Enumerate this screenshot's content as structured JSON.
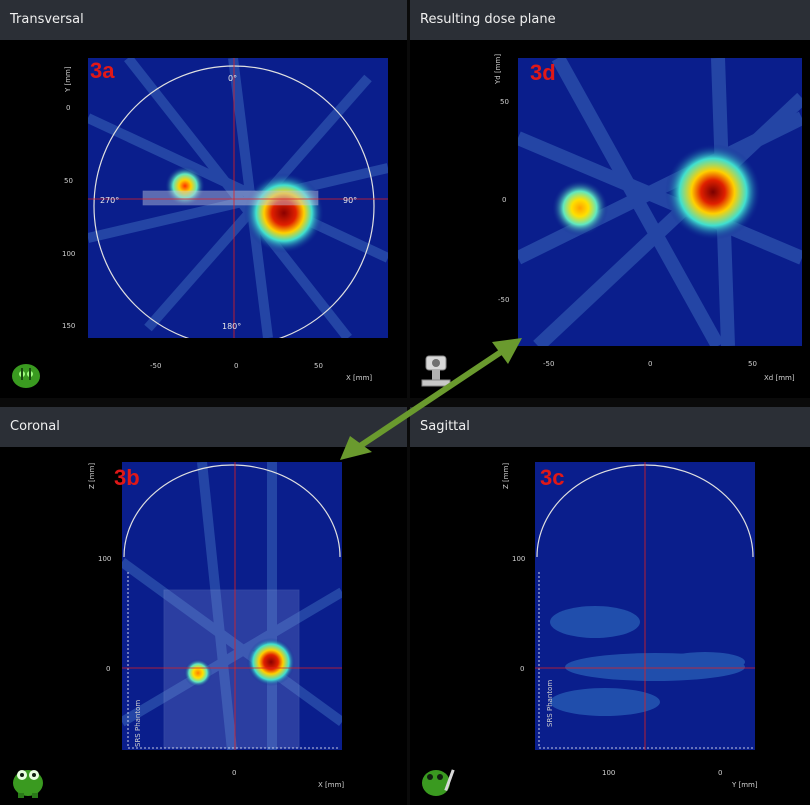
{
  "panels": {
    "transversal": {
      "title": "Transversal",
      "badge": "3a",
      "x_axis_label": "X [mm]",
      "y_axis_label": "Y [mm]",
      "x_ticks": [
        "-50",
        "0",
        "50"
      ],
      "y_ticks": [
        "0",
        "50",
        "100",
        "150"
      ],
      "angles": {
        "top": "0°",
        "right": "90°",
        "bottom": "180°",
        "left": "270°"
      }
    },
    "dose_plane": {
      "title": "Resulting dose plane",
      "badge": "3d",
      "x_axis_label": "Xd [mm]",
      "y_axis_label": "Yd [mm]",
      "x_ticks": [
        "-50",
        "0",
        "50"
      ],
      "y_ticks": [
        "50",
        "0",
        "-50"
      ]
    },
    "coronal": {
      "title": "Coronal",
      "badge": "3b",
      "x_axis_label": "X [mm]",
      "y_axis_label": "Z [mm]",
      "x_ticks": [
        "0"
      ],
      "y_ticks": [
        "100",
        "0"
      ],
      "phantom_label": "SRS Phantom"
    },
    "sagittal": {
      "title": "Sagittal",
      "badge": "3c",
      "x_axis_label": "Y [mm]",
      "y_axis_label": "Z [mm]",
      "x_ticks": [
        "100",
        "0"
      ],
      "y_ticks": [
        "100",
        "0"
      ],
      "phantom_label": "SRS Phantom"
    }
  },
  "colors": {
    "header_bg": "#2b2f36",
    "plot_bg": "#0a1e8c",
    "crosshair": "#e02020",
    "badge": "#e01818",
    "arrow": "#6a9a2e"
  },
  "icons": [
    "green-mascot-icon",
    "linac-machine-icon",
    "double-arrow-icon"
  ]
}
